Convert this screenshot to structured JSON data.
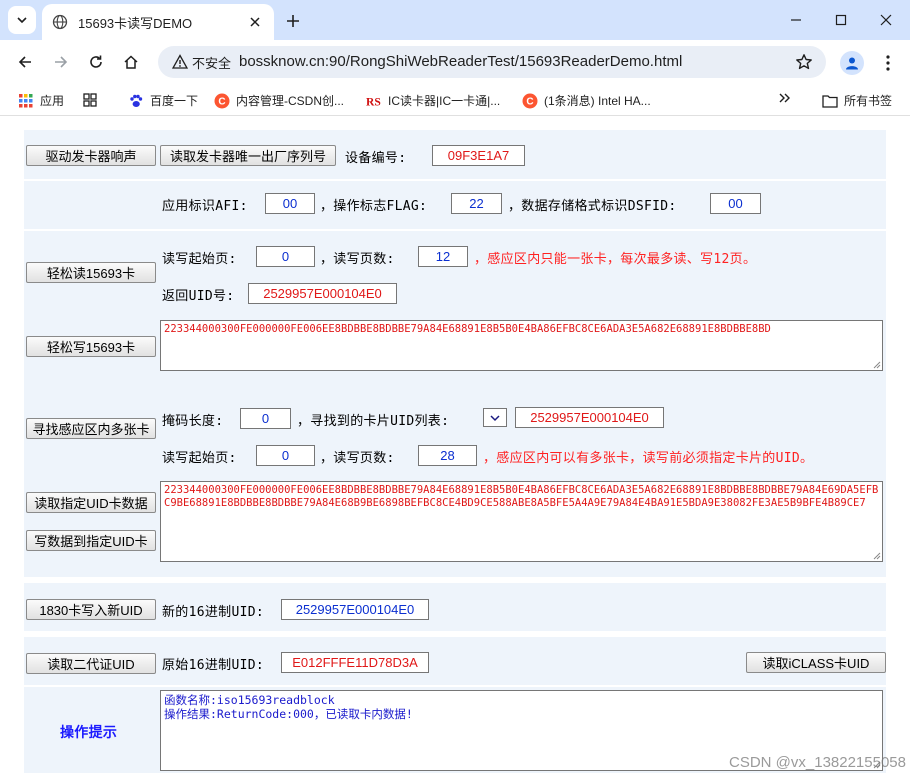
{
  "browser": {
    "tab_title": "15693卡读写DEMO",
    "security_label": "不安全",
    "url": "bossknow.cn:90/RongShiWebReaderTest/15693ReaderDemo.html",
    "bookmarks": [
      {
        "label": "应用",
        "icon": "apps-grid-icon"
      },
      {
        "label": "",
        "icon": "grid-icon"
      },
      {
        "label": "百度一下",
        "icon": "baidu-paw-icon"
      },
      {
        "label": "内容管理-CSDN创...",
        "icon": "csdn-icon"
      },
      {
        "label": "IC读卡器|IC一卡通|...",
        "icon": "rs-logo-icon"
      },
      {
        "label": "(1条消息) Intel HA...",
        "icon": "csdn-icon"
      }
    ],
    "all_bookmarks_label": "所有书签"
  },
  "row_beep": {
    "beep_button": "驱动发卡器响声",
    "read_serial_button": "读取发卡器唯一出厂序列号",
    "device_label": "设备编号:",
    "device_value": "09F3E1A7"
  },
  "row_afi": {
    "afi_label": "应用标识AFI:",
    "afi_value": "00",
    "flag_label": "，操作标志FLAG:",
    "flag_value": "22",
    "dsfid_label": "，数据存储格式标识DSFID:",
    "dsfid_value": "00"
  },
  "row_easy": {
    "easy_read_button": "轻松读15693卡",
    "easy_write_button": "轻松写15693卡",
    "start_page_label": "读写起始页:",
    "start_page_value": "0",
    "page_count_label": "，读写页数:",
    "page_count_value": "12",
    "note": "，感应区内只能一张卡，每次最多读、写12页。",
    "uid_label": "返回UID号:",
    "uid_value": "2529957E000104E0",
    "data_text": "223344000300FE000000FE006EE8BDBBE8BDBBE79A84E68891E8B5B0E4BA86EFBC8CE6ADA3E5A682E68891E8BDBBE8BD"
  },
  "row_multi": {
    "find_button": "寻找感应区内多张卡",
    "read_uid_button": "读取指定UID卡数据",
    "write_uid_button": "写数据到指定UID卡",
    "mask_label": "掩码长度:",
    "mask_value": "0",
    "found_label": "，寻找到的卡片UID列表:",
    "selected_uid": "2529957E000104E0",
    "start_page_label": "读写起始页:",
    "start_page_value": "0",
    "page_count_label": "，读写页数:",
    "page_count_value": "28",
    "note": "，感应区内可以有多张卡，读写前必须指定卡片的UID。",
    "data_text": "223344000300FE000000FE006EE8BDBBE8BDBBE79A84E68891E8B5B0E4BA86EFBC8CE6ADA3E5A682E68891E8BDBBE8BDBBE79A84E69DA5EFBC9BE68891E8BDBBE8BDBBE79A84E68B9BE6898BEFBC8CE4BD9CE588ABE8A5BFE5A4A9E79A84E4BA91E5BDA9E38082FE3AE5B9BFE4B89CE7"
  },
  "row_1830": {
    "button": "1830卡写入新UID",
    "label": "新的16进制UID:",
    "value": "2529957E000104E0"
  },
  "row_idcard": {
    "button": "读取二代证UID",
    "label": "原始16进制UID:",
    "value": "E012FFFE11D78D3A",
    "iclass_button": "读取iCLASS卡UID"
  },
  "row_tip": {
    "label": "操作提示",
    "line1": "函数名称:iso15693readblock",
    "line2": "操作结果:ReturnCode:000，已读取卡内数据!"
  },
  "watermark": "CSDN @vx_13822155058",
  "colors": {
    "panel_bg": "#eef4fb",
    "red_text": "#ff2222",
    "blue_text": "#1a1aff",
    "tabstrip": "#d3e3fd"
  }
}
